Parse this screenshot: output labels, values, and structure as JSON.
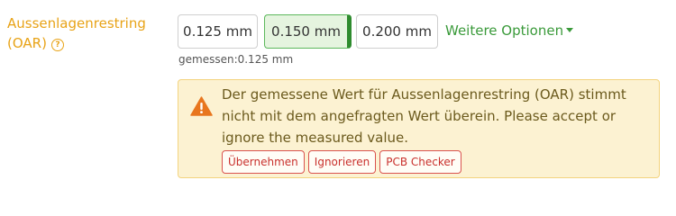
{
  "field": {
    "label": "Aussenlagenrestring (OAR)",
    "help_icon": "question-circle-icon"
  },
  "options": [
    {
      "label": "0.125 mm",
      "selected": false
    },
    {
      "label": "0.150 mm",
      "selected": true
    },
    {
      "label": "0.200 mm",
      "selected": false
    }
  ],
  "more_options_label": "Weitere Optionen",
  "measured_text": "gemessen:0.125 mm",
  "alert": {
    "icon": "warning-triangle-icon",
    "message": "Der gemessene Wert für Aussenlagenrestring (OAR) stimmt nicht mit dem angefragten Wert überein. Please accept or ignore the measured value.",
    "buttons": [
      "Übernehmen",
      "Ignorieren",
      "PCB Checker"
    ]
  },
  "colors": {
    "label": "#e8a317",
    "selected_bg": "#e5f4df",
    "selected_accent": "#2e8b2e",
    "link": "#3a9a3a",
    "alert_bg": "#fcf2d2",
    "warning_icon": "#e8761e",
    "action_button": "#c9302c"
  }
}
